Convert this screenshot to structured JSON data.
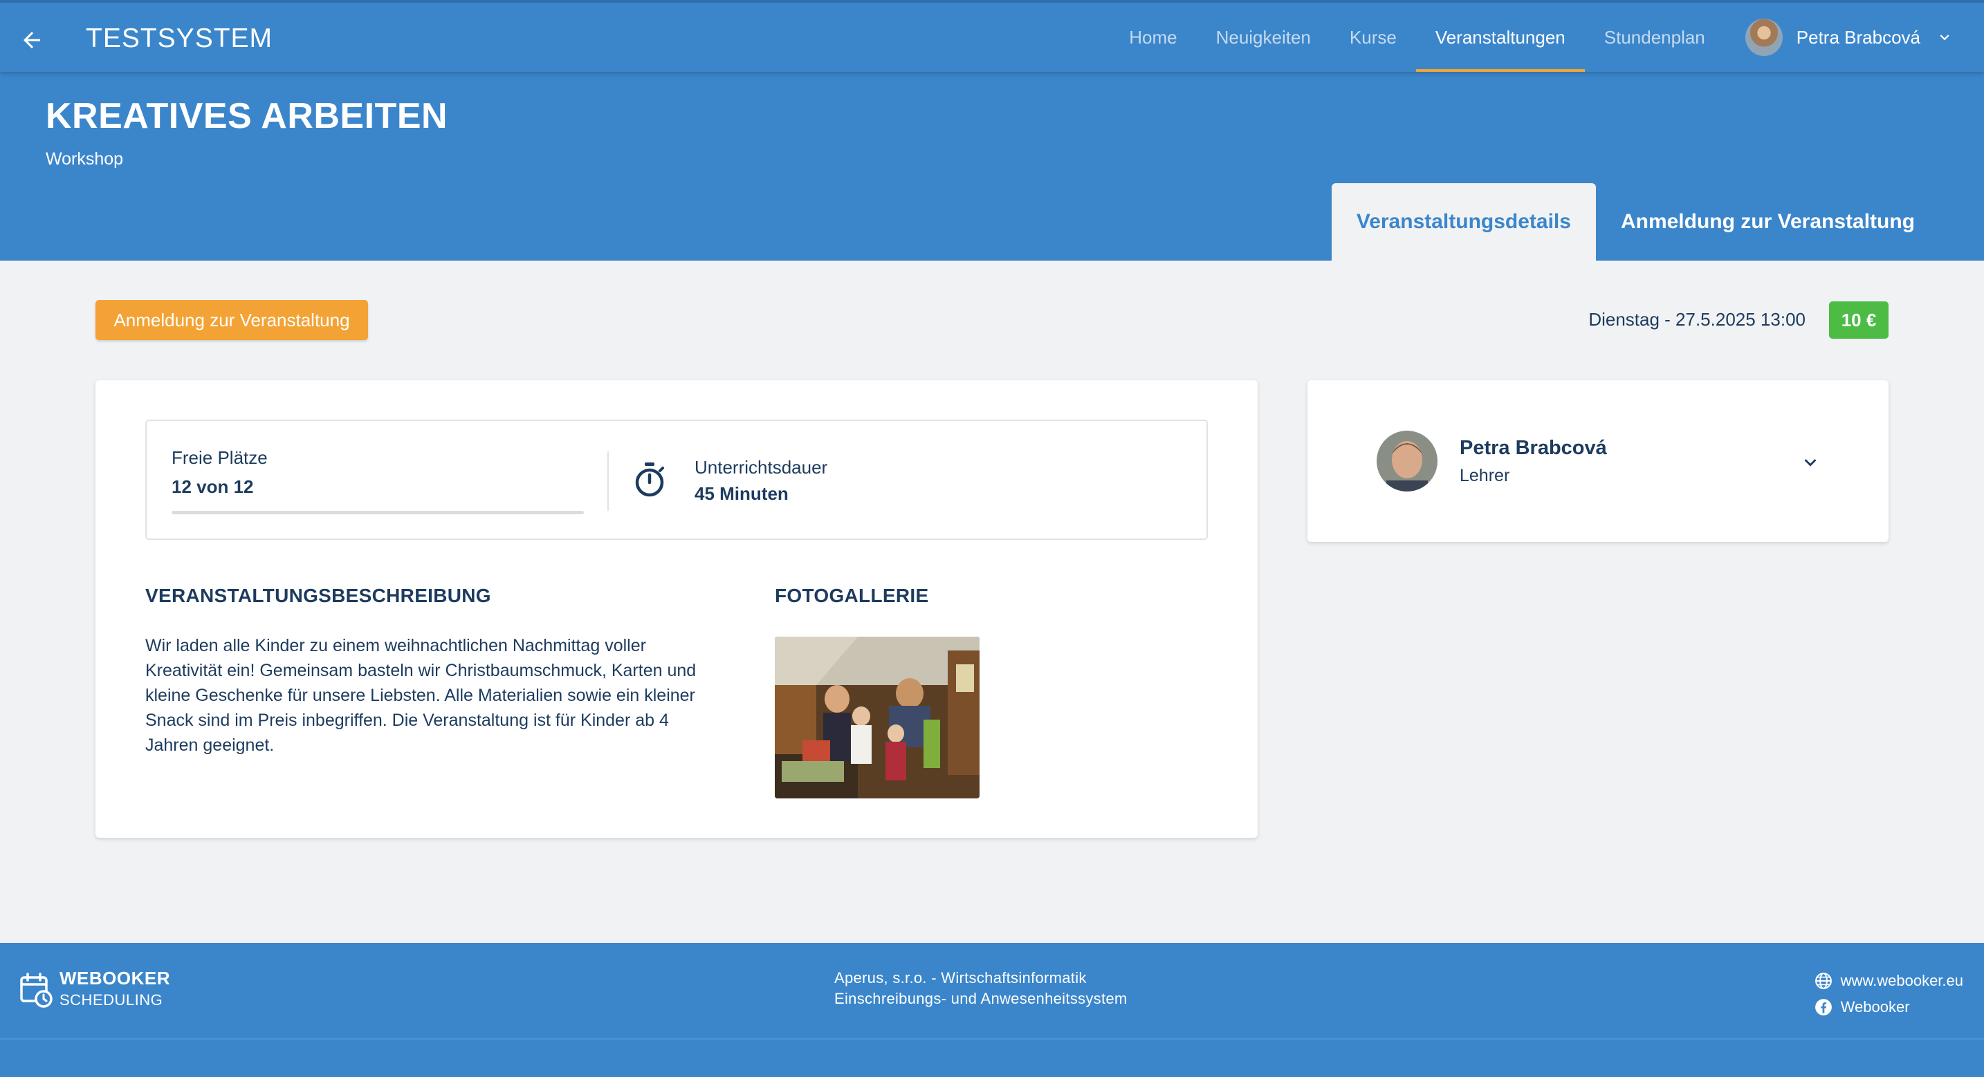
{
  "topbar": {
    "title": "TESTSYSTEM",
    "nav": [
      {
        "label": "Home",
        "active": false
      },
      {
        "label": "Neuigkeiten",
        "active": false
      },
      {
        "label": "Kurse",
        "active": false
      },
      {
        "label": "Veranstaltungen",
        "active": true
      },
      {
        "label": "Stundenplan",
        "active": false
      }
    ],
    "user_name": "Petra Brabcová"
  },
  "header": {
    "title": "KREATIVES ARBEITEN",
    "subtitle": "Workshop",
    "tabs": [
      {
        "label": "Veranstaltungsdetails",
        "active": true
      },
      {
        "label": "Anmeldung zur Veranstaltung",
        "active": false
      }
    ]
  },
  "actions": {
    "register_label": "Anmeldung zur Veranstaltung",
    "date": "Dienstag - 27.5.2025 13:00",
    "price": "10 €"
  },
  "info": {
    "seats_label": "Freie Plätze",
    "seats_value": "12 von 12",
    "seats_fraction": 0,
    "duration_label": "Unterrichtsdauer",
    "duration_value": "45 Minuten"
  },
  "description": {
    "heading": "VERANSTALTUNGSBESCHREIBUNG",
    "text": "Wir laden alle Kinder zu einem weihnachtlichen Nachmittag voller Kreativität ein! Gemeinsam basteln wir Christbaumschmuck, Karten und kleine Geschenke für unsere Liebsten. Alle Materialien sowie ein kleiner Snack sind im Preis inbegriffen. Die Veranstaltung ist für Kinder ab 4 Jahren geeignet."
  },
  "gallery": {
    "heading": "FOTOGALLERIE"
  },
  "teacher": {
    "name": "Petra Brabcová",
    "role": "Lehrer"
  },
  "footer": {
    "brand": "WEBOOKER",
    "brand_sub": "SCHEDULING",
    "company": "Aperus, s.r.o. - Wirtschaftsinformatik",
    "system": "Einschreibungs- und Anwesenheitssystem",
    "website": "www.webooker.eu",
    "facebook": "Webooker"
  },
  "colors": {
    "primary": "#3b86cb",
    "accent": "#f3a335",
    "price": "#4cbc45",
    "text": "#1d3b5e",
    "background": "#f1f2f4"
  }
}
